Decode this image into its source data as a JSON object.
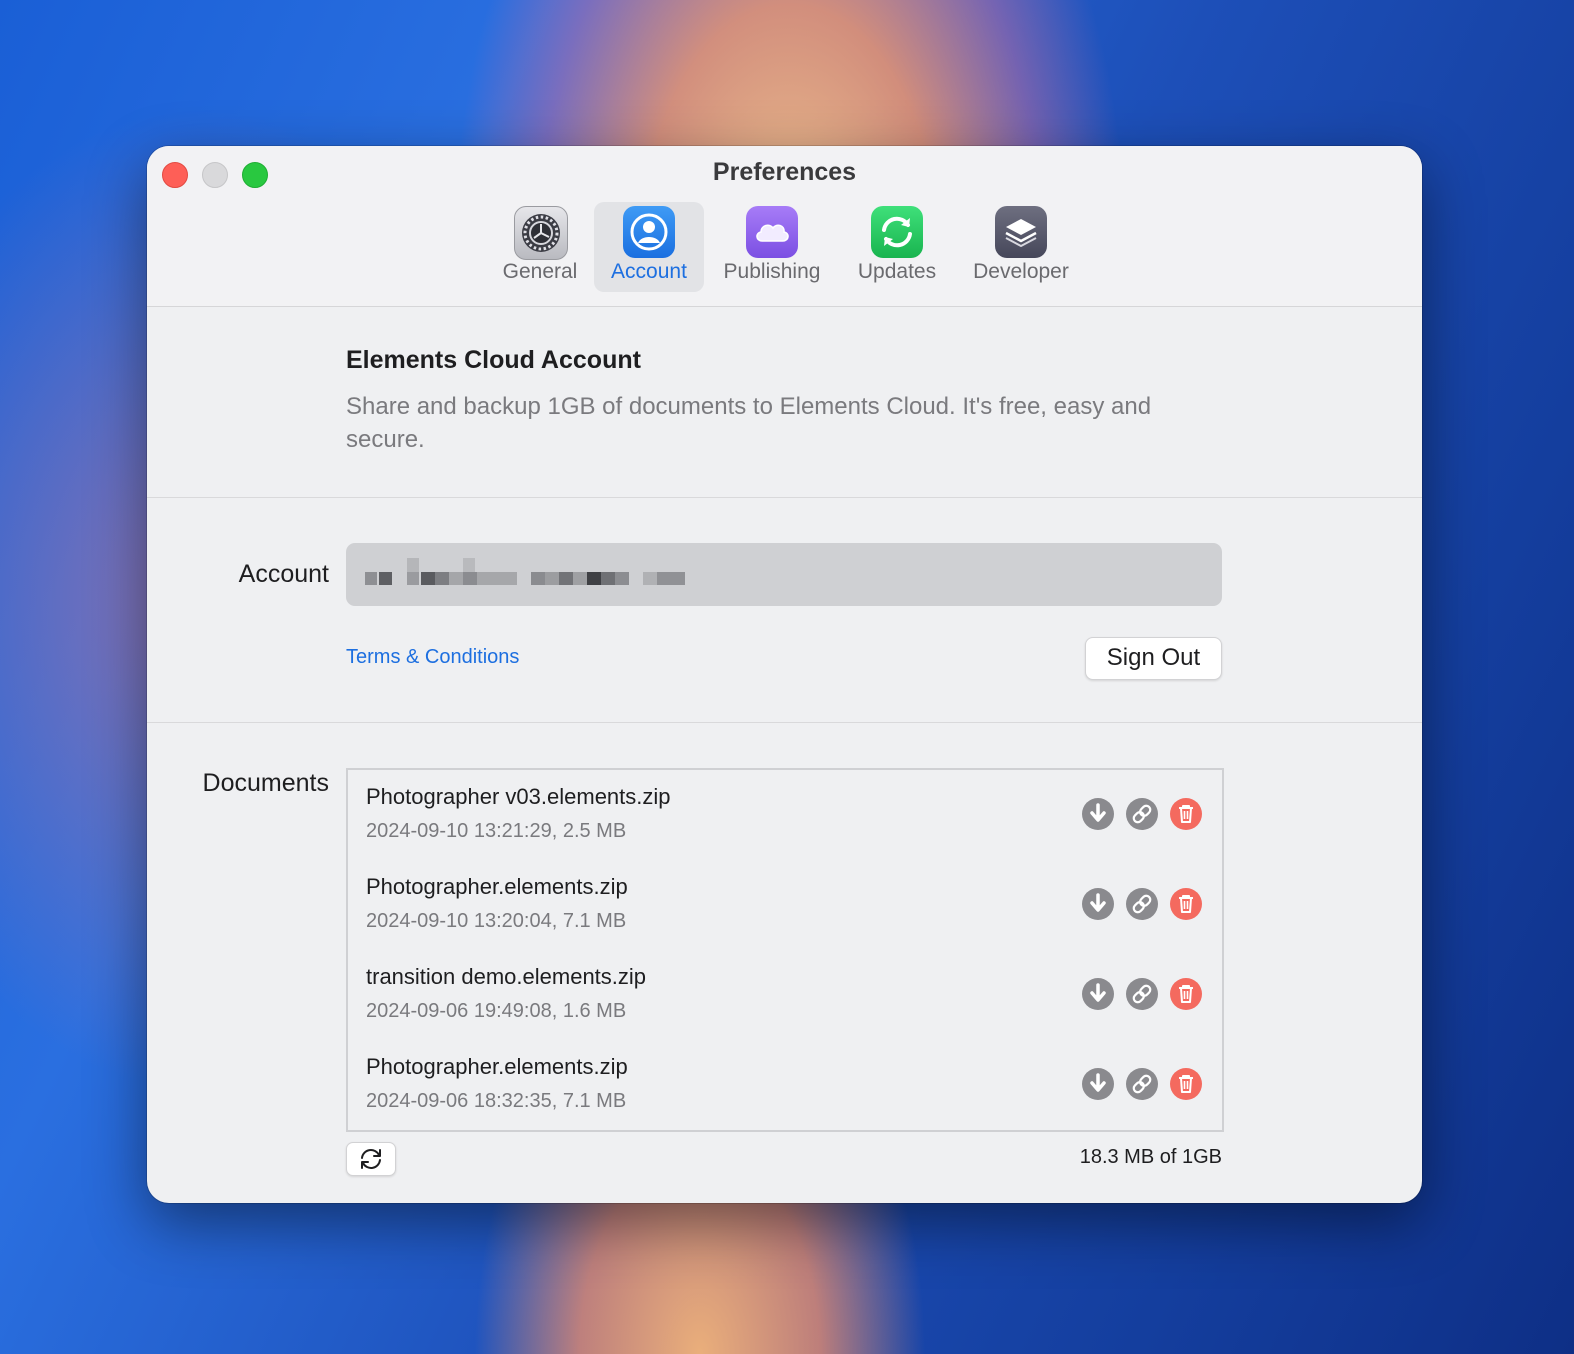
{
  "window": {
    "title": "Preferences"
  },
  "tabs": [
    {
      "label": "General",
      "icon": "gear-icon"
    },
    {
      "label": "Account",
      "icon": "person-icon",
      "active": true
    },
    {
      "label": "Publishing",
      "icon": "cloud-icon"
    },
    {
      "label": "Updates",
      "icon": "sync-icon"
    },
    {
      "label": "Developer",
      "icon": "layers-icon"
    }
  ],
  "header": {
    "title": "Elements Cloud Account",
    "description": "Share and backup 1GB of documents to Elements Cloud. It's free, easy and secure."
  },
  "account": {
    "label": "Account",
    "terms_label": "Terms & Conditions",
    "signout_label": "Sign Out"
  },
  "documents": {
    "label": "Documents",
    "items": [
      {
        "name": "Photographer v03.elements.zip",
        "meta": "2024-09-10 13:21:29, 2.5 MB"
      },
      {
        "name": "Photographer.elements.zip",
        "meta": "2024-09-10 13:20:04, 7.1 MB"
      },
      {
        "name": "transition demo.elements.zip",
        "meta": "2024-09-06 19:49:08, 1.6 MB"
      },
      {
        "name": "Photographer.elements.zip",
        "meta": "2024-09-06 18:32:35, 7.1 MB"
      }
    ],
    "usage": "18.3 MB of 1GB"
  },
  "colors": {
    "accent": "#1d6fe0",
    "delete": "#f46a5f",
    "action_gray": "#8a8a8e",
    "close": "#fe5f57",
    "maximize": "#29c840"
  }
}
